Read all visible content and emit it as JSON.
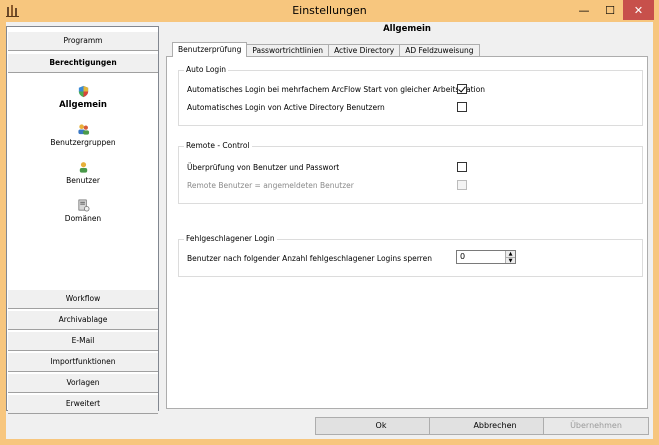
{
  "window": {
    "title": "Einstellungen",
    "minimize_glyph": "—",
    "maximize_glyph": "☐",
    "close_glyph": "✕"
  },
  "nav": {
    "top_buttons": [
      {
        "label": "Programm"
      },
      {
        "label": "Berechtigungen"
      }
    ],
    "items": [
      {
        "label": "Allgemein",
        "icon": "shield-icon"
      },
      {
        "label": "Benutzergruppen",
        "icon": "users-group-icon"
      },
      {
        "label": "Benutzer",
        "icon": "user-icon"
      },
      {
        "label": "Domänen",
        "icon": "domain-server-icon"
      }
    ],
    "bottom_buttons": [
      {
        "label": "Workflow"
      },
      {
        "label": "Archivablage"
      },
      {
        "label": "E-Mail"
      },
      {
        "label": "Importfunktionen"
      },
      {
        "label": "Vorlagen"
      },
      {
        "label": "Erweitert"
      }
    ]
  },
  "panel": {
    "title": "Allgemein",
    "tabs": [
      {
        "label": "Benutzerprüfung"
      },
      {
        "label": "Passwortrichtlinien"
      },
      {
        "label": "Active Directory"
      },
      {
        "label": "AD Feldzuweisung"
      }
    ],
    "groups": {
      "auto_login": {
        "legend": "Auto Login",
        "options": [
          {
            "label": "Automatisches Login bei mehrfachem ArcFlow Start von gleicher Arbeitsstation",
            "checked": true
          },
          {
            "label": "Automatisches Login von Active Directory Benutzern",
            "checked": false
          }
        ]
      },
      "remote_control": {
        "legend": "Remote - Control",
        "options": [
          {
            "label": "Überprüfung von Benutzer und Passwort",
            "checked": false
          },
          {
            "label": "Remote Benutzer = angemeldeten Benutzer",
            "checked": false,
            "disabled": true
          }
        ]
      },
      "failed_login": {
        "legend": "Fehlgeschlagener Login",
        "label": "Benutzer nach folgender Anzahl fehlgeschlagener Logins sperren",
        "value": "0"
      }
    }
  },
  "buttons": {
    "ok": "Ok",
    "cancel": "Abbrechen",
    "apply": "Übernehmen"
  }
}
